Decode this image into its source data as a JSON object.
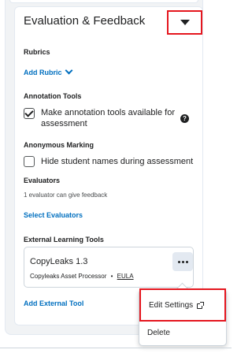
{
  "section": {
    "title": "Evaluation & Feedback"
  },
  "rubrics": {
    "heading": "Rubrics",
    "add_label": "Add Rubric"
  },
  "annotation": {
    "heading": "Annotation Tools",
    "checkbox_label_line1": "Make annotation tools available for",
    "checkbox_label_line2": "assessment",
    "checked": true,
    "help_glyph": "?"
  },
  "anonymous": {
    "heading": "Anonymous Marking",
    "checkbox_label": "Hide student names during assessment",
    "checked": false
  },
  "evaluators": {
    "heading": "Evaluators",
    "summary": "1 evaluator can give feedback",
    "select_label": "Select Evaluators"
  },
  "external_tools": {
    "heading": "External Learning Tools",
    "tool_name": "CopyLeaks 1.3",
    "tool_desc": "Copyleaks Asset Processor",
    "separator": "•",
    "eula": "EULA",
    "add_label": "Add External Tool"
  },
  "menu": {
    "edit_label": "Edit Settings",
    "delete_label": "Delete"
  },
  "colors": {
    "link": "#006fbf",
    "highlight": "#e5161e"
  },
  "icons": [
    "chevron-down-icon",
    "caret-down-icon",
    "help-icon",
    "more-icon",
    "external-link-icon",
    "checkmark-icon"
  ]
}
